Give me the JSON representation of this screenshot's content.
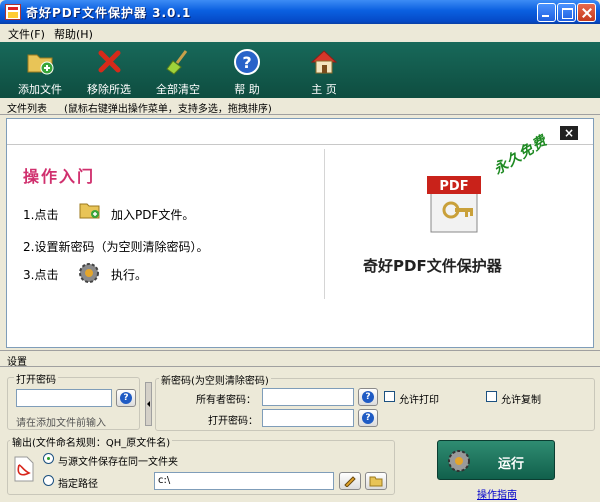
{
  "window": {
    "title": "奇好PDF文件保护器 3.0.1"
  },
  "menu": [
    {
      "label": "文件(F)"
    },
    {
      "label": "帮助(H)"
    }
  ],
  "toolbar": {
    "items": [
      {
        "label": "添加文件",
        "icon": "add-folder-icon"
      },
      {
        "label": "移除所选",
        "icon": "red-x-icon"
      },
      {
        "label": "全部清空",
        "icon": "broom-icon"
      },
      {
        "label": "帮 助",
        "icon": "help-icon"
      },
      {
        "label": "主 页",
        "icon": "home-icon"
      }
    ]
  },
  "list": {
    "title": "文件列表",
    "hint": "(鼠标右键弹出操作菜单，支持多选，拖拽排序)"
  },
  "guide": {
    "title": "操作入门",
    "step1_prefix": "1.点击",
    "step1_text": "加入PDF文件。",
    "step2_text": "2.设置新密码（为空则清除密码）。",
    "step3_prefix": "3.点击",
    "step3_text": "执行。",
    "forever_free": "永久免费",
    "brand": "奇好PDF文件保护器",
    "pdf_badge": "PDF",
    "close": "×"
  },
  "settings": {
    "header": "设置",
    "open_password": {
      "legend": "打开密码",
      "value": "",
      "hint": "请在添加文件前输入"
    },
    "new_password": {
      "legend": "新密码(为空则清除密码)",
      "owner_label": "所有者密码：",
      "owner_value": "",
      "open_label": "打开密码：",
      "open_value": "",
      "allow_print": "允许打印",
      "allow_copy": "允许复制"
    },
    "output": {
      "legend": "输出(文件命名规则：QH_原文件名)",
      "opt_same": "与源文件保存在同一文件夹",
      "opt_custom": "指定路径",
      "path": "c:\\"
    },
    "run_label": "运行",
    "help_link": "操作指南"
  },
  "colors": {
    "toolbar": "#0e4d40",
    "title_pink": "#d0306e",
    "free_green": "#1e8a22",
    "run": "#11604c"
  }
}
